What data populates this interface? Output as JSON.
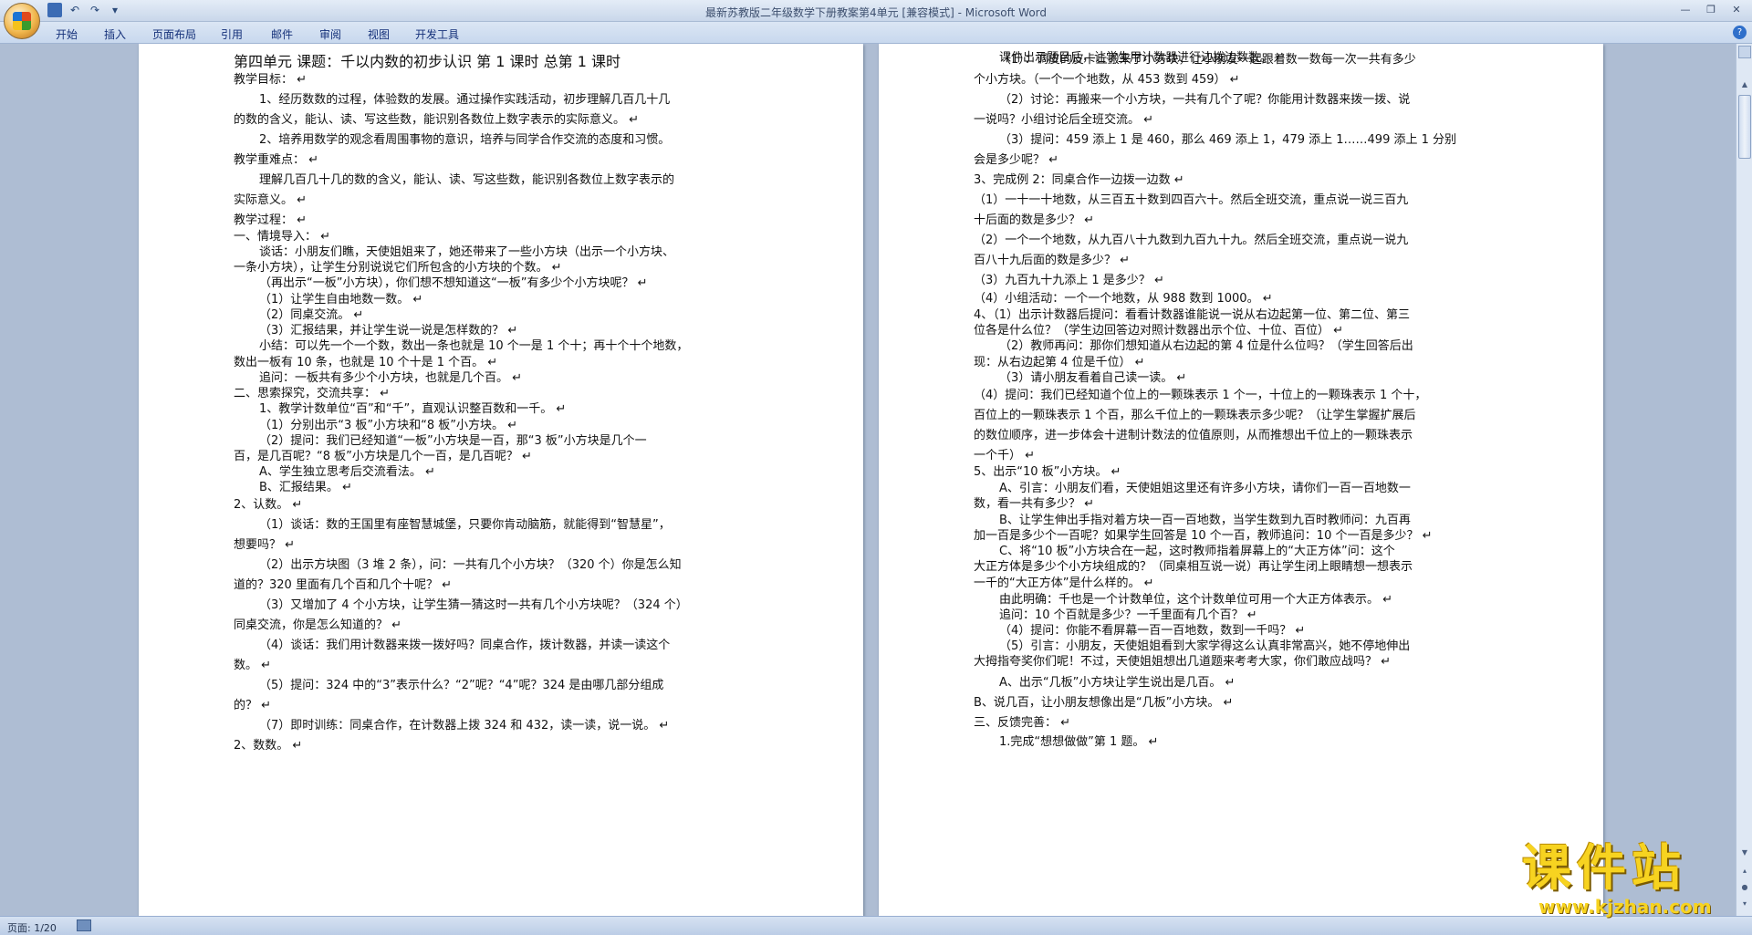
{
  "window": {
    "title": "最新苏教版二年级数学下册教案第4单元 [兼容模式] - Microsoft Word"
  },
  "ribbon": {
    "tabs": [
      "开始",
      "插入",
      "页面布局",
      "引用",
      "邮件",
      "审阅",
      "视图",
      "开发工具"
    ]
  },
  "status": {
    "page_count": "页面: 1/20"
  },
  "watermark": {
    "title": "课件站",
    "url": "www.kjzhan.com"
  },
  "left_page": {
    "lines": [
      "第四单元   课题：千以内数的初步认识  第 1 课时   总第 1 课时",
      "教学目标： ↵",
      "1、经历数数的过程，体验数的发展。通过操作实践活动，初步理解几百几十几",
      "的数的含义，能认、读、写这些数，能识别各数位上数字表示的实际意义。 ↵",
      "2、培养用数学的观念看周围事物的意识，培养与同学合作交流的态度和习惯。",
      "教学重难点： ↵",
      "理解几百几十几的数的含义，能认、读、写这些数，能识别各数位上数字表示的",
      "实际意义。 ↵",
      "教学过程： ↵",
      "一、情境导入： ↵",
      "谈话：小朋友们瞧，天使姐姐来了，她还带来了一些小方块（出示一个小方块、",
      "一条小方块），让学生分别说说它们所包含的小方块的个数。 ↵",
      "（再出示“一板”小方块），你们想不想知道这“一板”有多少个小方块呢？ ↵",
      "（1）让学生自由地数一数。 ↵",
      "（2）同桌交流。 ↵",
      "（3）汇报结果，并让学生说一说是怎样数的？ ↵",
      "小结：可以先一个一个数，数出一条也就是 10 个一是 1 个十；再十个十个地数，",
      "数出一板有 10 条，也就是 10 个十是 1 个百。 ↵",
      "追问：一板共有多少个小方块，也就是几个百。 ↵",
      "二、思索探究，交流共享： ↵",
      "1、教学计数单位“百”和“千”，直观认识整百数和一千。 ↵",
      "（1）分别出示“3 板”小方块和“8 板”小方块。 ↵",
      "（2）提问：我们已经知道“一板”小方块是一百，那“3 板”小方块是几个一",
      "百，是几百呢？“8 板”小方块是几个一百，是几百呢？ ↵",
      "A、学生独立思考后交流看法。 ↵",
      "B、汇报结果。 ↵",
      "2、认数。 ↵",
      "（1）谈话：数的王国里有座智慧城堡，只要你肯动脑筋，就能得到“智慧星”，",
      "想要吗？ ↵",
      "（2）出示方块图（3 堆 2 条），问：一共有几个小方块？（320 个）你是怎么知",
      "道的？320 里面有几个百和几个十呢？ ↵",
      "（3）又增加了 4 个小方块，让学生猜一猜这时一共有几个小方块呢？（324 个）",
      "同桌交流，你是怎么知道的？ ↵",
      "（4）谈话：我们用计数器来拨一拨好吗？同桌合作，拨计数器，并读一读这个",
      "数。 ↵",
      "（5）提问：324 中的“3”表示什么？“2”呢？“4”呢？324 是由哪几部分组成",
      "的？ ↵",
      "（7）即时训练：同桌合作，在计数器上拨 324 和 432，读一读，说一说。 ↵",
      "2、数数。 ↵"
    ]
  },
  "right_page": {
    "lines": [
      "（1）：调皮的皮卡丘搬来了小方块，让小朋友一起跟着数一数每一次一共有多少",
      "个小方块。（一个一个地数，从 453 数到 459） ↵",
      "（2）讨论：再搬来一个小方块，一共有几个了呢？你能用计数器来拨一拨、说",
      "一说吗？小组讨论后全班交流。 ↵",
      "（3）提问：459 添上 1 是 460，那么 469 添上 1，479 添上 1……499 添上 1 分别",
      "会是多少呢？ ↵",
      "3、完成例 2：同桌合作一边拨一边数 ↵",
      "（1）一十一十地数，从三百五十数到四百六十。然后全班交流，重点说一说三百九",
      "十后面的数是多少？ ↵",
      "（2）一个一个地数，从九百八十九数到九百九十九。然后全班交流，重点说一说九",
      "百八十九后面的数是多少？ ↵",
      "（3）九百九十九添上 1 是多少？ ↵",
      "（4）小组活动：一个一个地数，从 988 数到 1000。 ↵",
      "4、（1）出示计数器后提问：看看计数器谁能说一说从右边起第一位、第二位、第三",
      "位各是什么位？（学生边回答边对照计数器出示个位、十位、百位） ↵",
      "（2）教师再问：那你们想知道从右边起的第 4 位是什么位吗？（学生回答后出",
      "现：从右边起第 4 位是千位） ↵",
      "（3）请小朋友看着自己读一读。 ↵",
      "（4）提问：我们已经知道个位上的一颗珠表示 1 个一，十位上的一颗珠表示 1 个十，",
      "百位上的一颗珠表示 1 个百，那么千位上的一颗珠表示多少呢？（让学生掌握扩展后",
      "的数位顺序，进一步体会十进制计数法的位值原则，从而推想出千位上的一颗珠表示",
      "一个千） ↵",
      "5、出示“10 板”小方块。 ↵",
      "A、引言：小朋友们看，天使姐姐这里还有许多小方块，请你们一百一百地数一",
      "数，看一共有多少？ ↵",
      "B、让学生伸出手指对着方块一百一百地数，当学生数到九百时教师问：九百再",
      "加一百是多少个一百呢？如果学生回答是 10 个一百，教师追问：10 个一百是多少？ ↵",
      "C、将“10 板”小方块合在一起，这时教师指着屏幕上的“大正方体”问：这个",
      "大正方体是多少个小方块组成的？（同桌相互说一说）再让学生闭上眼睛想一想表示",
      "一千的“大正方体”是什么样的。 ↵",
      "由此明确：千也是一个计数单位，这个计数单位可用一个大正方体表示。 ↵",
      "追问：10 个百就是多少？一千里面有几个百？ ↵",
      "（4）提问：你能不看屏幕一百一百地数，数到一千吗？ ↵",
      "（5）引言：小朋友，天使姐姐看到大家学得这么认真非常高兴，她不停地伸出",
      "大拇指夸奖你们呢！不过，天使姐姐想出几道题来考考大家，你们敢应战吗？ ↵",
      "A、出示“几板”小方块让学生说出是几百。 ↵",
      "B、说几百，让小朋友想像出是“几板”小方块。 ↵",
      "三、反馈完善： ↵",
      "1.完成“想想做做”第 1 题。 ↵",
      "课件出示题目后，让学生用计数器进行边拨边数数。 ↵"
    ]
  }
}
